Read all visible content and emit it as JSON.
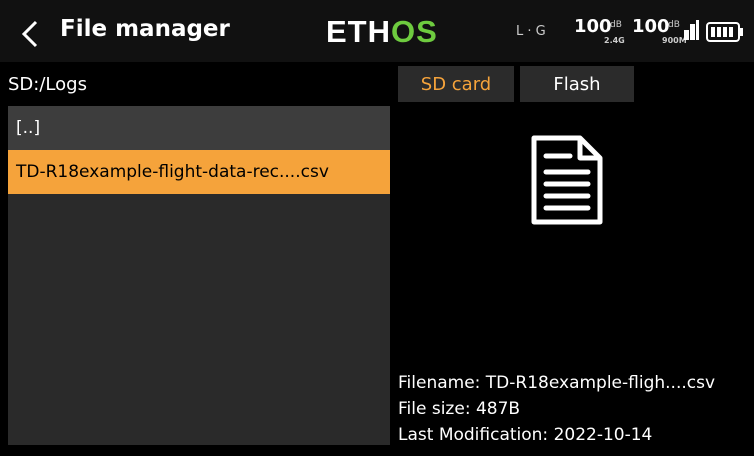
{
  "header": {
    "title": "File manager",
    "brand_left": "ETH",
    "brand_right": "OS",
    "telemetry": "L · G",
    "rssi_1": {
      "value": "100",
      "unit": "dB",
      "band": "2.4G"
    },
    "rssi_2": {
      "value": "100",
      "unit": "dB",
      "band": "900M"
    }
  },
  "left": {
    "path": "SD:/Logs",
    "files": [
      {
        "label": "[..]",
        "selected": false
      },
      {
        "label": "TD-R18example-flight-data-rec....csv",
        "selected": true
      }
    ]
  },
  "tabs": [
    {
      "label": "SD card",
      "active": true
    },
    {
      "label": "Flash",
      "active": false
    }
  ],
  "details": {
    "filename": "Filename: TD-R18example-fligh....csv",
    "filesize": "File size: 487B",
    "modified": "Last Modification: 2022-10-14"
  },
  "colors": {
    "accent": "#f5a33b",
    "brand_green": "#6ecb3f"
  },
  "icons": [
    "back-arrow-icon",
    "signal-bars-icon",
    "battery-icon",
    "document-icon"
  ]
}
